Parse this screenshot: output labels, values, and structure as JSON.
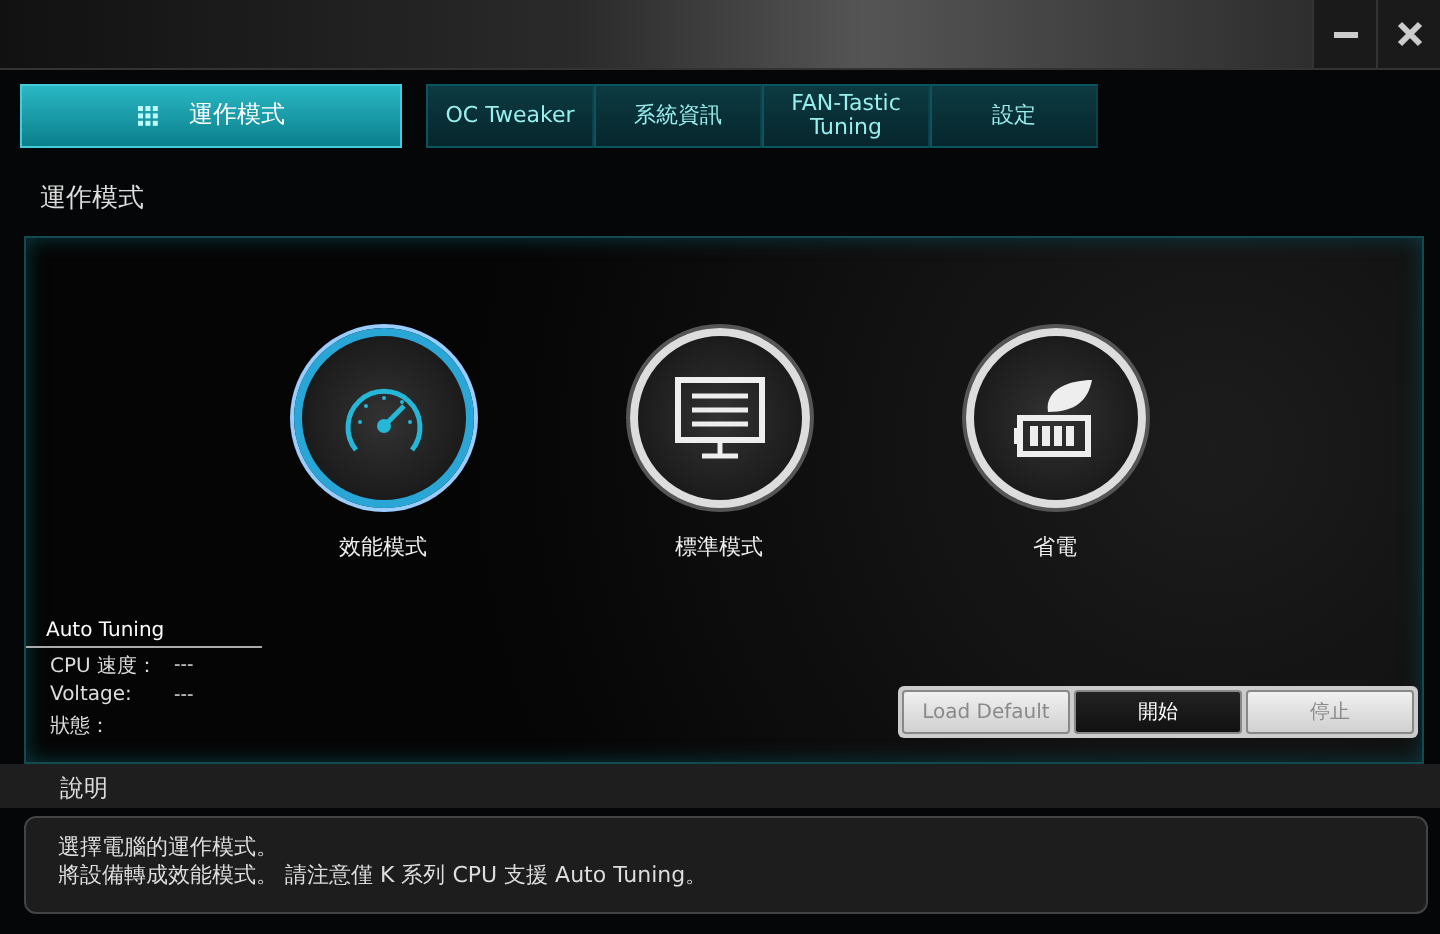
{
  "tabs": [
    {
      "label": "運作模式",
      "selected": true
    },
    {
      "label": "OC Tweaker",
      "selected": false
    },
    {
      "label": "系統資訊",
      "selected": false
    },
    {
      "label": "FAN-Tastic Tuning",
      "selected": false
    },
    {
      "label": "設定",
      "selected": false
    }
  ],
  "section_title": "運作模式",
  "modes": [
    {
      "kind": "performance",
      "label": "效能模式",
      "selected": true
    },
    {
      "kind": "standard",
      "label": "標準模式",
      "selected": false
    },
    {
      "kind": "eco",
      "label": "省電",
      "selected": false
    }
  ],
  "auto_tuning": {
    "title": "Auto Tuning",
    "rows": [
      {
        "label": "CPU 速度：",
        "value": "---"
      },
      {
        "label": "Voltage:",
        "value": "---"
      },
      {
        "label": "狀態：",
        "value": ""
      }
    ]
  },
  "buttons": [
    {
      "label": "Load Default",
      "disabled": true
    },
    {
      "label": "開始",
      "disabled": false
    },
    {
      "label": "停止",
      "disabled": true
    }
  ],
  "description": {
    "title": "說明",
    "lines": [
      "選擇電腦的運作模式。",
      "將設備轉成效能模式。 請注意僅 K 系列 CPU 支援 Auto Tuning。"
    ]
  }
}
